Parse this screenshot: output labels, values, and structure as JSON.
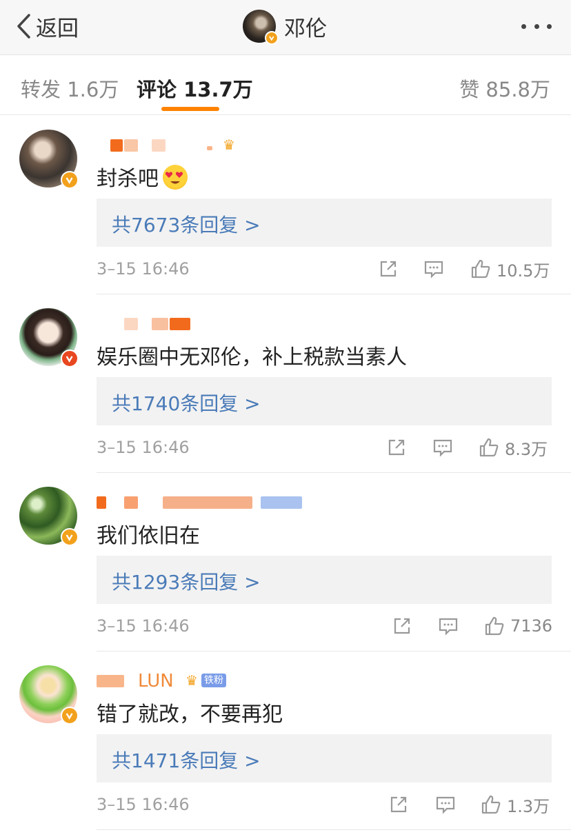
{
  "nav": {
    "back_label": "返回",
    "title": "邓伦"
  },
  "tabs": [
    {
      "label": "转发 1.6万"
    },
    {
      "label": "评论 13.7万"
    },
    {
      "label": "赞 85.8万"
    }
  ],
  "colors": {
    "accent": "#ff8200",
    "link": "#4a7bb8",
    "verified_gold": "#f2a11c",
    "verified_red": "#e8471f"
  },
  "comments": [
    {
      "text": "封杀吧",
      "emoji": "heart-eyes-emoji",
      "replies": "共7673条回复 >",
      "time": "3–15 16:46",
      "likes": "10.5万"
    },
    {
      "text": "娱乐圈中无邓伦，补上税款当素人",
      "replies": "共1740条回复 >",
      "time": "3–15 16:46",
      "likes": "8.3万"
    },
    {
      "text": "我们依旧在",
      "replies": "共1293条回复 >",
      "time": "3–15 16:46",
      "likes": "7136"
    },
    {
      "text": "错了就改，不要再犯",
      "username_visible": "LUN",
      "badge": "铁粉",
      "replies": "共1471条回复 >",
      "time": "3–15 16:46",
      "likes": "1.3万"
    }
  ]
}
